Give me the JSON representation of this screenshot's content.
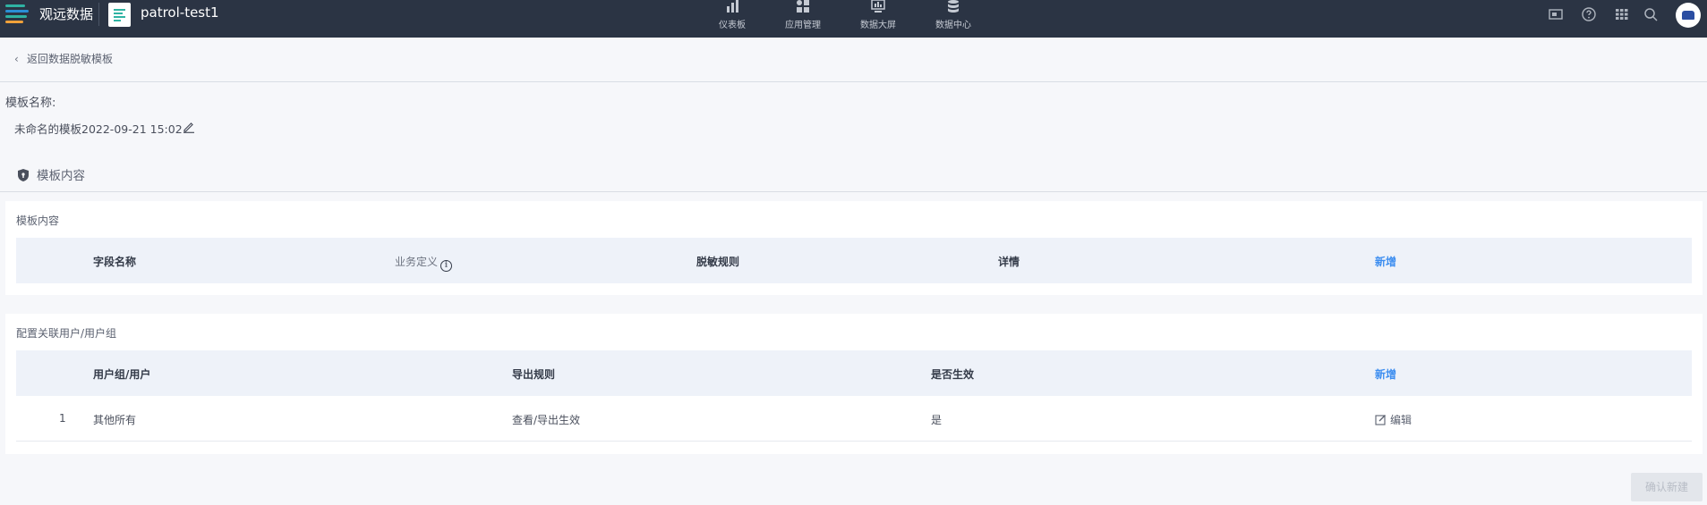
{
  "topbar": {
    "brand": "观远数据",
    "app_name": "patrol-test1",
    "nav": [
      {
        "label": "仪表板",
        "icon": "bar-chart-icon"
      },
      {
        "label": "应用管理",
        "icon": "apps-icon"
      },
      {
        "label": "数据大屏",
        "icon": "screen-icon"
      },
      {
        "label": "数据中心",
        "icon": "database-icon"
      }
    ],
    "right_icons": [
      "monitor-icon",
      "help-icon",
      "grid-icon",
      "search-icon",
      "avatar"
    ]
  },
  "breadcrumb": {
    "back_label": "返回数据脱敏模板"
  },
  "template": {
    "name_label": "模板名称:",
    "name_value": "未命名的模板2022-09-21 15:02"
  },
  "section": {
    "title": "模板内容"
  },
  "content_card": {
    "title": "模板内容",
    "columns": [
      "字段名称",
      "业务定义",
      "脱敏规则",
      "详情"
    ],
    "add_label": "新增"
  },
  "users_card": {
    "title": "配置关联用户/用户组",
    "columns": [
      "用户组/用户",
      "导出规则",
      "是否生效"
    ],
    "add_label": "新增",
    "rows": [
      {
        "index": "1",
        "group": "其他所有",
        "rule": "查看/导出生效",
        "active": "是",
        "action": "编辑"
      }
    ]
  },
  "confirm_button": "确认新建",
  "colors": {
    "topbar": "#2b3444",
    "accent": "#3d8ef0",
    "table_header": "#eef2f9"
  }
}
